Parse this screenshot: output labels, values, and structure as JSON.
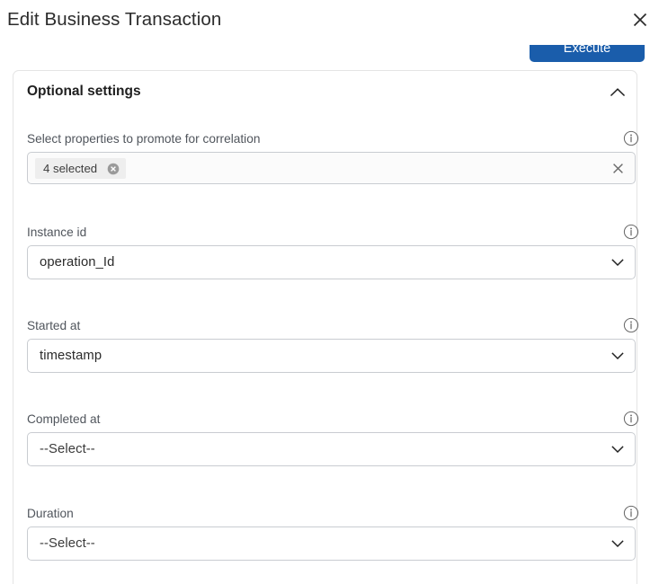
{
  "header": {
    "title": "Edit Business Transaction",
    "close_icon": "close-icon"
  },
  "action_bar": {
    "execute_label": "Execute",
    "execute_color": "#1a5dab"
  },
  "card": {
    "title": "Optional settings",
    "collapse_icon": "chevron-up-icon",
    "expanded": true
  },
  "fields": [
    {
      "label": "Select properties to promote for correlation",
      "type": "multiselect",
      "chip_label": "4 selected",
      "chip_remove_icon": "circle-close-icon",
      "clear_icon": "close-icon",
      "info_icon": "info-icon"
    },
    {
      "label": "Instance id",
      "type": "select",
      "value": "operation_Id",
      "chevron_icon": "chevron-down-icon",
      "info_icon": "info-icon"
    },
    {
      "label": "Started at",
      "type": "select",
      "value": "timestamp",
      "chevron_icon": "chevron-down-icon",
      "info_icon": "info-icon"
    },
    {
      "label": "Completed at",
      "type": "select",
      "value": "--Select--",
      "chevron_icon": "chevron-down-icon",
      "info_icon": "info-icon"
    },
    {
      "label": "Duration",
      "type": "select",
      "value": "--Select--",
      "chevron_icon": "chevron-down-icon",
      "info_icon": "info-icon"
    }
  ]
}
